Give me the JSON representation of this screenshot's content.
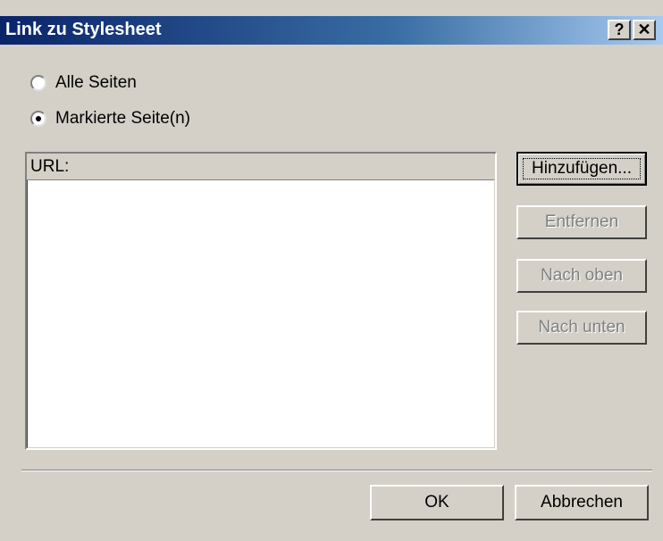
{
  "window": {
    "title": "Link zu Stylesheet",
    "help_label": "?",
    "close_label": "✕"
  },
  "radios": [
    {
      "label": "Alle Seiten",
      "checked": false
    },
    {
      "label": "Markierte Seite(n)",
      "checked": true
    }
  ],
  "list": {
    "column_header": "URL:"
  },
  "side_buttons": {
    "add": "Hinzufügen...",
    "remove": "Entfernen",
    "up": "Nach oben",
    "down": "Nach unten"
  },
  "footer": {
    "ok": "OK",
    "cancel": "Abbrechen"
  }
}
